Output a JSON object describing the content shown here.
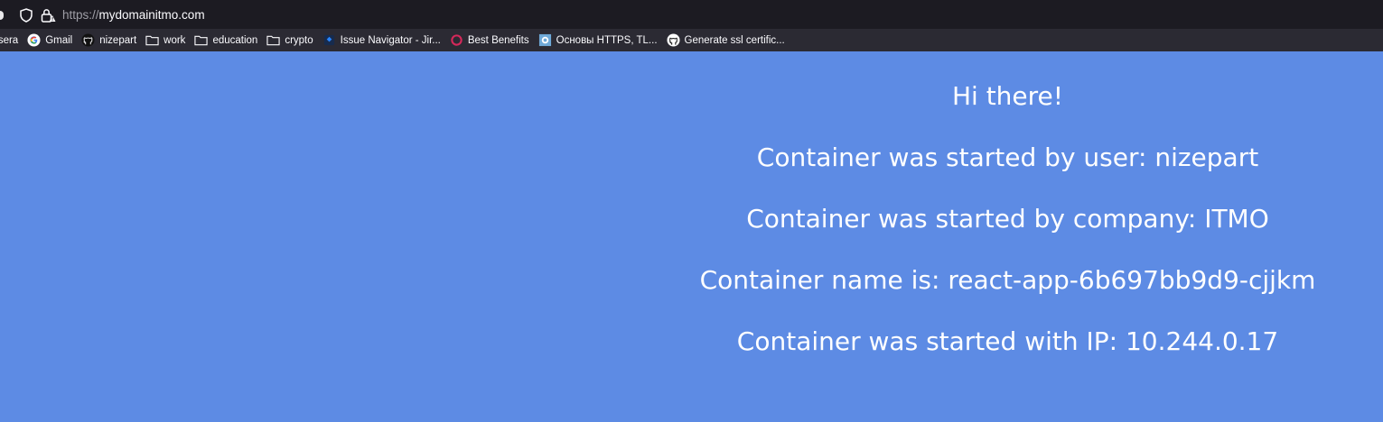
{
  "address_bar": {
    "url_scheme": "https://",
    "url_host": "mydomainitmo.com"
  },
  "bookmarks": [
    {
      "label": "rsera",
      "icon": "coursera-icon"
    },
    {
      "label": "Gmail",
      "icon": "google-icon"
    },
    {
      "label": "nizepart",
      "icon": "github-icon"
    },
    {
      "label": "work",
      "icon": "folder-icon"
    },
    {
      "label": "education",
      "icon": "folder-icon"
    },
    {
      "label": "crypto",
      "icon": "folder-icon"
    },
    {
      "label": "Issue Navigator - Jir...",
      "icon": "jira-icon"
    },
    {
      "label": "Best Benefits",
      "icon": "benefits-icon"
    },
    {
      "label": "Основы HTTPS, TL...",
      "icon": "site-icon"
    },
    {
      "label": "Generate ssl certific...",
      "icon": "github-icon"
    }
  ],
  "page": {
    "greeting": "Hi there!",
    "user_line": "Container was started by user: nizepart",
    "company_line": "Container was started by company: ITMO",
    "name_line": "Container name is: react-app-6b697bb9d9-cjjkm",
    "ip_line": "Container was started with IP: 10.244.0.17"
  },
  "colors": {
    "page_background": "#5d8be4",
    "toolbar_background": "#1c1b22",
    "bookmarks_background": "#2b2a33",
    "text": "#ffffff"
  }
}
